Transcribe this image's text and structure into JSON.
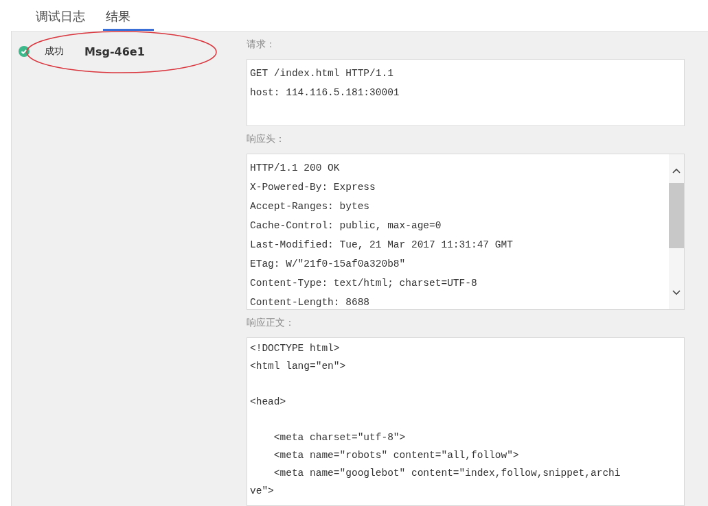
{
  "tabs": [
    {
      "label": "调试日志",
      "selected": false
    },
    {
      "label": "结果",
      "selected": true
    }
  ],
  "messages": [
    {
      "kind": "success",
      "status_label": "成功",
      "name": "Msg-46e1"
    }
  ],
  "annotations": [
    {
      "kind": "ellipse"
    }
  ],
  "sections": [
    {
      "label": "请求：",
      "kind": "plain",
      "content": "GET /index.html HTTP/1.1\nhost: 114.116.5.181:30001"
    },
    {
      "label": "响应头：",
      "kind": "scroll",
      "content": "HTTP/1.1 200 OK\nX-Powered-By: Express\nAccept-Ranges: bytes\nCache-Control: public, max-age=0\nLast-Modified: Tue, 21 Mar 2017 11:31:47 GMT\nETag: W/\"21f0-15af0a320b8\"\nContent-Type: text/html; charset=UTF-8\nContent-Length: 8688"
    },
    {
      "label": "响应正文：",
      "kind": "fill",
      "content": "<!DOCTYPE html>\n<html lang=\"en\">\n\n<head>\n\n    <meta charset=\"utf-8\">\n    <meta name=\"robots\" content=\"all,follow\">\n    <meta name=\"googlebot\" content=\"index,follow,snippet,archi\nve\">"
    }
  ]
}
